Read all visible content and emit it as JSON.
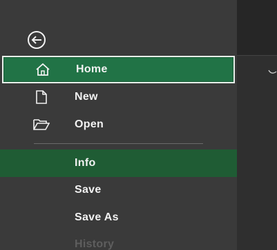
{
  "backstage": {
    "back_label": "",
    "items": [
      {
        "label": "Home",
        "icon": "home-icon"
      },
      {
        "label": "New",
        "icon": "new-document-icon"
      },
      {
        "label": "Open",
        "icon": "open-folder-icon"
      }
    ],
    "secondary_items": [
      {
        "label": "Info"
      },
      {
        "label": "Save"
      },
      {
        "label": "Save As"
      },
      {
        "label": "History"
      }
    ]
  },
  "colors": {
    "nav_background": "#3a3a3a",
    "selected_green": "#217346",
    "active_green": "#1f5c34",
    "text": "#f2f2f2",
    "disabled_text": "#5e5e5e"
  }
}
